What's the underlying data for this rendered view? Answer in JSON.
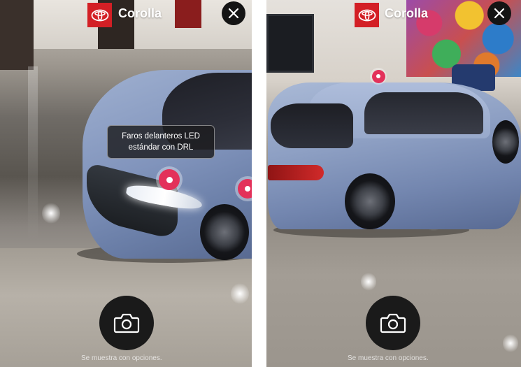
{
  "brand": {
    "logo_icon": "toyota-logo-icon",
    "badge_color": "#d31f25"
  },
  "screens": [
    {
      "model_title": "Corolla",
      "close_icon": "close-icon",
      "tooltip": {
        "line1": "Faros delanteros LED",
        "line2": "estándar con DRL"
      },
      "camera_icon": "camera-icon",
      "disclaimer": "Se muestra con opciones."
    },
    {
      "model_title": "Corolla",
      "close_icon": "close-icon",
      "camera_icon": "camera-icon",
      "disclaimer": "Se muestra con opciones."
    }
  ],
  "colors": {
    "hotspot": "#e3315a",
    "close_button": "#141414",
    "camera_button": "#1a1a1a"
  }
}
